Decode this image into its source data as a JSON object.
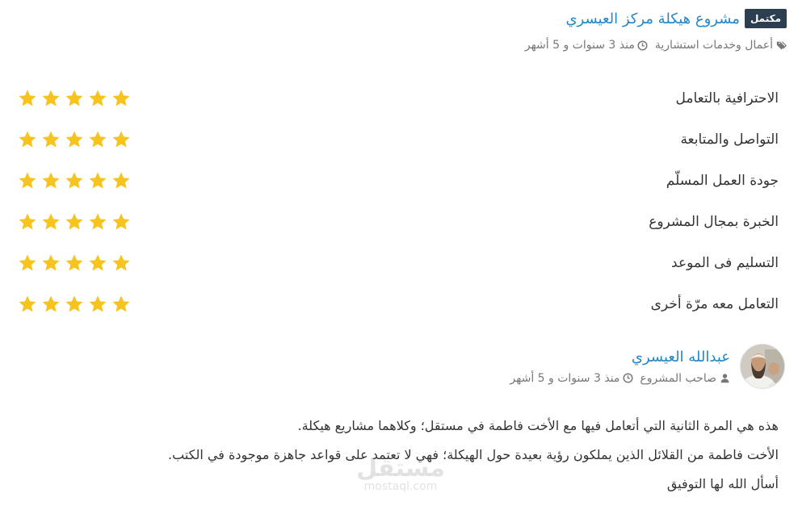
{
  "project": {
    "status_badge": "مكتمل",
    "title": "مشروع هيكلة مركز العيسري",
    "category": "أعمال وخدمات استشارية",
    "time_ago": "منذ 3 سنوات و 5 أشهر"
  },
  "ratings": [
    {
      "label": "الاحترافية بالتعامل",
      "stars": 5
    },
    {
      "label": "التواصل والمتابعة",
      "stars": 5
    },
    {
      "label": "جودة العمل المسلّم",
      "stars": 5
    },
    {
      "label": "الخبرة بمجال المشروع",
      "stars": 5
    },
    {
      "label": "التسليم فى الموعد",
      "stars": 5
    },
    {
      "label": "التعامل معه مرّة أخرى",
      "stars": 5
    }
  ],
  "review": {
    "reviewer_name": "عبدالله العيسري",
    "reviewer_role": "صاحب المشروع",
    "time_ago": "منذ 3 سنوات و 5 أشهر",
    "paragraphs": [
      "هذه هي المرة الثانية التي أتعامل فيها مع الأخت فاطمة في مستقل؛ وكلاهما مشاريع هيكلة.",
      "الأخت فاطمة من القلائل الذين يملكون رؤية بعيدة حول الهيكلة؛ فهي لا تعتمد على قواعد جاهزة موجودة في الكتب.",
      "أسأل الله لها التوفيق"
    ]
  },
  "watermark": {
    "arabic": "مستقل",
    "latin": "mostaql.com"
  },
  "icons": {
    "category": "tags-icon",
    "time": "clock-icon",
    "role": "user-icon",
    "star": "star-icon"
  },
  "colors": {
    "link": "#2486c7",
    "badge_bg": "#2c3e50",
    "star": "#f7c41f",
    "meta_text": "#777777",
    "body_text": "#333333"
  }
}
